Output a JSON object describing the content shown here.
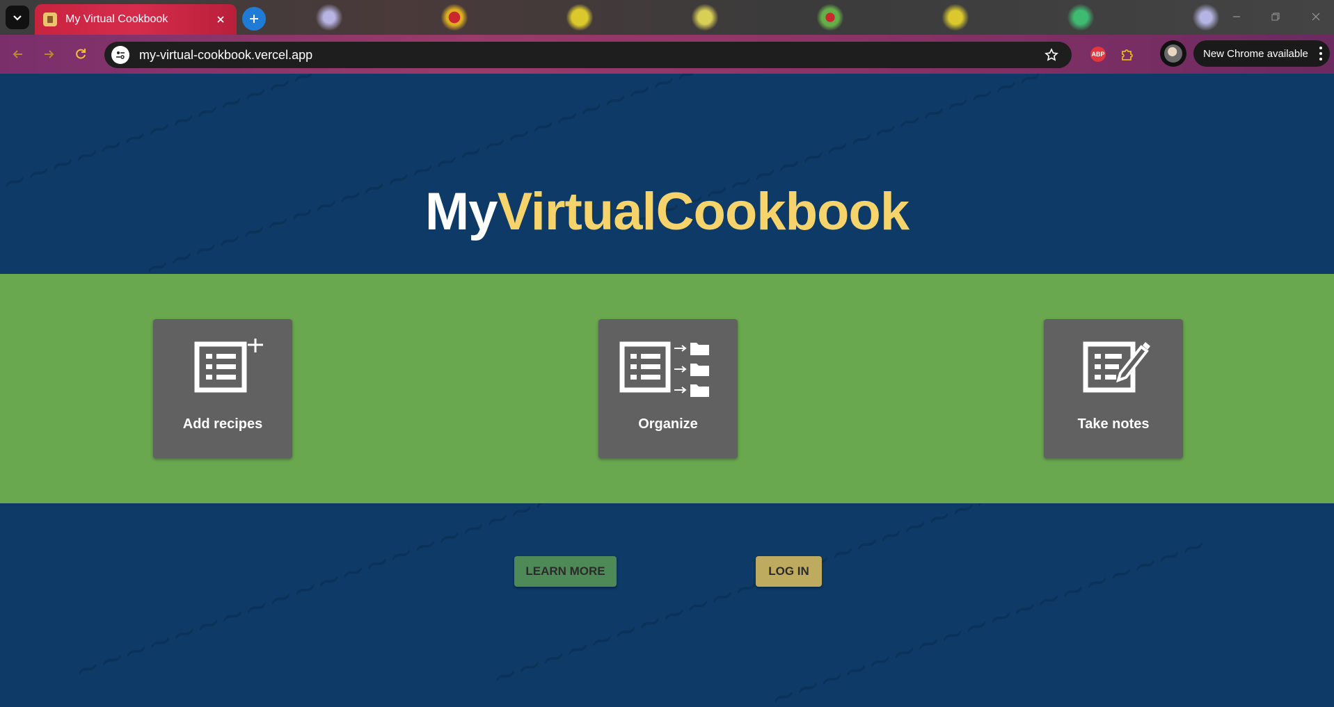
{
  "browser": {
    "tab": {
      "title": "My Virtual Cookbook"
    },
    "address_bar": {
      "url": "my-virtual-cookbook.vercel.app"
    },
    "extensions": {
      "adblock_label": "ABP"
    },
    "update_notice": "New Chrome available"
  },
  "hero": {
    "logo_part_1": "My",
    "logo_part_2": "VirtualCookbook",
    "colors": {
      "logo_white": "#ffffff",
      "logo_accent": "#f6d46b",
      "background": "#0d3a66"
    }
  },
  "features": {
    "background": "#69a84f",
    "cards": [
      {
        "label": "Add recipes",
        "icon": "list-add-icon"
      },
      {
        "label": "Organize",
        "icon": "list-to-folders-icon"
      },
      {
        "label": "Take notes",
        "icon": "list-edit-icon"
      }
    ]
  },
  "actions": {
    "learn_more": "LEARN MORE",
    "log_in": "LOG IN",
    "colors": {
      "learn_more": "#4e8a57",
      "log_in": "#bfab5f"
    }
  }
}
